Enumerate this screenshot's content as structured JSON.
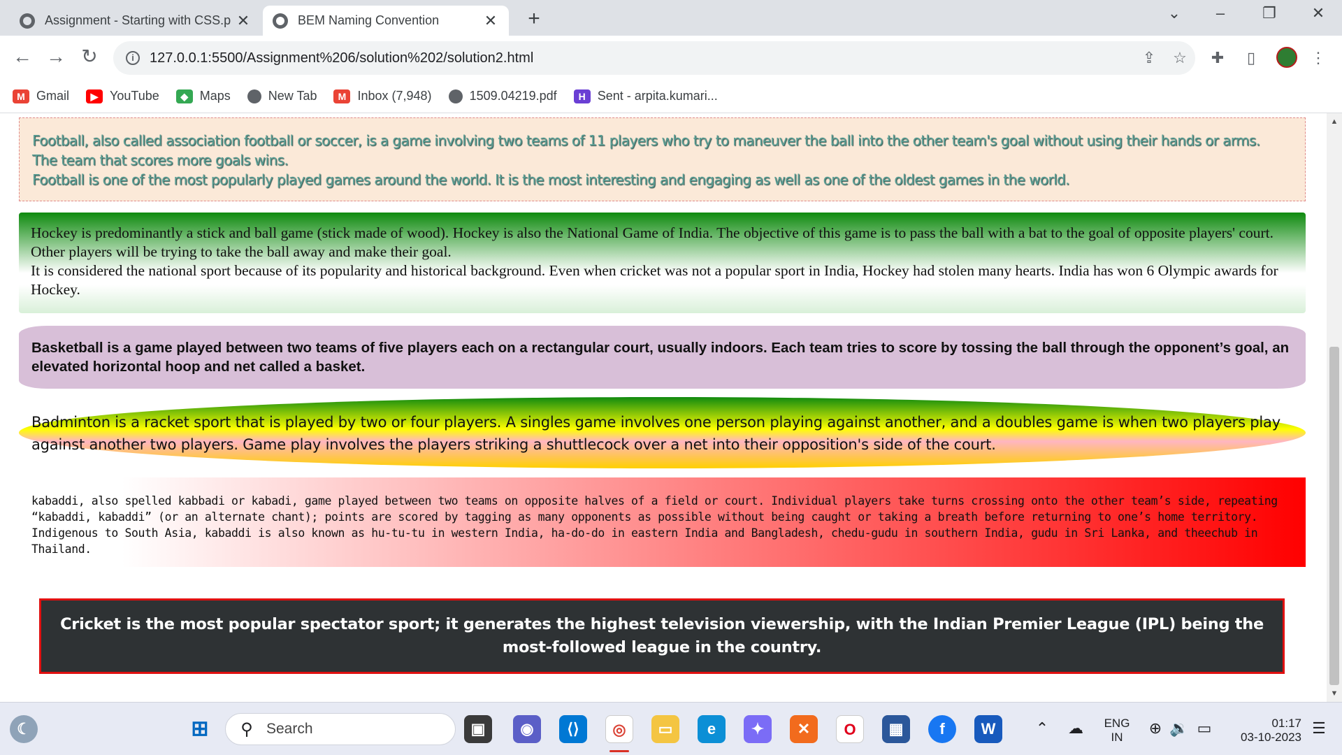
{
  "browser": {
    "tabs": [
      {
        "title": "Assignment - Starting with CSS.p",
        "active": false
      },
      {
        "title": "BEM Naming Convention",
        "active": true
      }
    ],
    "url": "127.0.0.1:5500/Assignment%206/solution%202/solution2.html",
    "bookmarks": [
      {
        "label": "Gmail",
        "icon": "gmail-icon",
        "color": "#ea4335"
      },
      {
        "label": "YouTube",
        "icon": "youtube-icon",
        "color": "#ff0000"
      },
      {
        "label": "Maps",
        "icon": "maps-icon",
        "color": "#34a853"
      },
      {
        "label": "New Tab",
        "icon": "globe-icon",
        "color": "#5f6368"
      },
      {
        "label": "Inbox (7,948)",
        "icon": "gmail-icon",
        "color": "#ea4335"
      },
      {
        "label": "1509.04219.pdf",
        "icon": "globe-icon",
        "color": "#5f6368"
      },
      {
        "label": "Sent - arpita.kumari...",
        "icon": "hackerrank-icon",
        "color": "#6a3fd4"
      }
    ]
  },
  "content": {
    "football": [
      "Football, also called association football or soccer, is a game involving two teams of 11 players who try to maneuver the ball into the other team's goal without using their hands or arms.",
      "The team that scores more goals wins.",
      "Football is one of the most popularly played games around the world. It is the most interesting and engaging as well as one of the oldest games in the world."
    ],
    "hockey": [
      "Hockey is predominantly a stick and ball game (stick made of wood). Hockey is also the National Game of India. The objective of this game is to pass the ball with a bat to the goal of opposite players' court. Other players will be trying to take the ball away and make their goal.",
      "It is considered the national sport because of its popularity and historical background. Even when cricket was not a popular sport in India, Hockey had stolen many hearts. India has won 6 Olympic awards for Hockey."
    ],
    "basketball": "Basketball is a game played between two teams of five players each on a rectangular court, usually indoors. Each team tries to score by tossing the ball through the opponent’s goal, an elevated horizontal hoop and net called a basket.",
    "badminton": "Badminton is a racket sport that is played by two or four players. A singles game involves one person playing against another, and a doubles game is when two players play against another two players. Game play involves the players striking a shuttlecock over a net into their opposition's side of the court.",
    "kabaddi": "kabaddi, also spelled kabbadi or kabadi, game played between two teams on opposite halves of a field or court. Individual players take turns crossing onto the other team’s side, repeating “kabaddi, kabaddi” (or an alternate chant); points are scored by tagging as many opponents as possible without being caught or taking a breath before returning to one’s home territory. Indigenous to South Asia, kabaddi is also known as hu-tu-tu in western India, ha-do-do in eastern India and Bangladesh, chedu-gudu in southern India, gudu in Sri Lanka, and theechub in Thailand.",
    "cricket": "Cricket is the most popular spectator sport; it generates the highest television viewership, with the Indian Premier League (IPL) being the most-followed league in the country."
  },
  "taskbar": {
    "search_placeholder": "Search",
    "language_line1": "ENG",
    "language_line2": "IN",
    "time": "01:17",
    "date": "03-10-2023"
  }
}
